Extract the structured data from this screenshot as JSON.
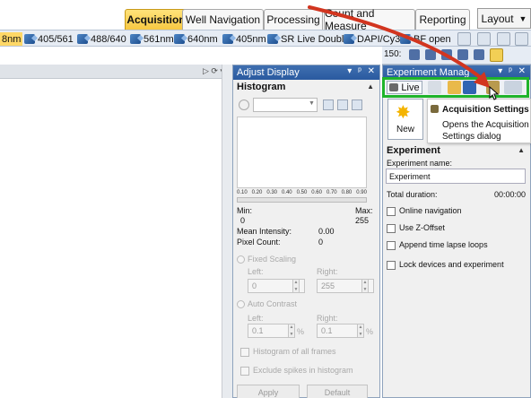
{
  "tabs": [
    {
      "label": "Acquisition",
      "active": true
    },
    {
      "label": "Well Navigation",
      "active": false
    },
    {
      "label": "Processing",
      "active": false
    },
    {
      "label": "Count and Measure",
      "active": false
    },
    {
      "label": "Reporting",
      "active": false
    }
  ],
  "layout_label": "Layout",
  "toolbar": {
    "channels": [
      "8nm",
      "405/561",
      "488/640",
      "561nm",
      "640nm",
      "405nm",
      "SR Live Double",
      "DAPI/Cy3",
      "BF open"
    ],
    "zoom_value": "150:"
  },
  "adjust_display": {
    "title": "Adjust Display",
    "histogram_header": "Histogram",
    "ticks": [
      "0.10",
      "0.20",
      "0.30",
      "0.40",
      "0.50",
      "0.60",
      "0.70",
      "0.80",
      "0.90"
    ],
    "min_label": "Min:",
    "max_label": "Max:",
    "min_value": "0",
    "max_value": "255",
    "mean_label": "Mean Intensity:",
    "mean_value": "0.00",
    "pixel_label": "Pixel Count:",
    "pixel_value": "0",
    "fixed_scaling": "Fixed Scaling",
    "left_label": "Left:",
    "right_label": "Right:",
    "fixed_left": "0",
    "fixed_right": "255",
    "auto_contrast": "Auto Contrast",
    "auto_left": "0.1",
    "auto_right": "0.1",
    "percent": "%",
    "hist_all_frames": "Histogram of all frames",
    "exclude_spikes": "Exclude spikes in histogram",
    "apply": "Apply",
    "default": "Default"
  },
  "experiment": {
    "title": "Experiment Manag",
    "live_label": "Live",
    "new_label": "New",
    "section": "Experiment",
    "name_label": "Experiment name:",
    "name_value": "Experiment",
    "duration_label": "Total duration:",
    "duration_value": "00:00:00",
    "options": [
      "Online navigation",
      "Use Z-Offset",
      "Append time lapse loops",
      "Lock devices and experiment"
    ]
  },
  "tooltip": {
    "title": "Acquisition Settings",
    "body": "Opens the Acquisition Settings dialog"
  },
  "colors": {
    "highlight": "#1fb42b",
    "arrow": "#d2351f",
    "active_tab": "#f7c842",
    "panel_title": "#2a5aa0"
  }
}
